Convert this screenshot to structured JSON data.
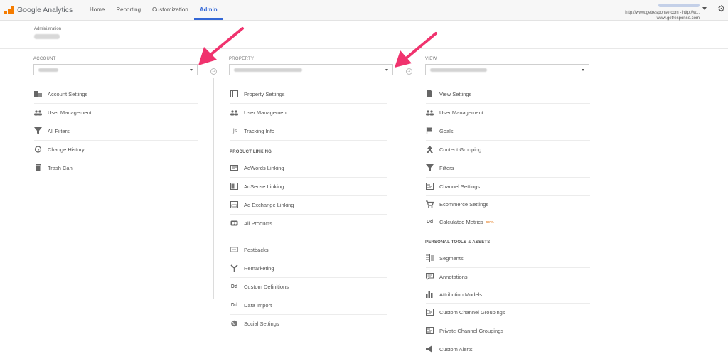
{
  "app": {
    "title": "Google Analytics"
  },
  "nav": [
    "Home",
    "Reporting",
    "Customization",
    "Admin"
  ],
  "account_info": {
    "line1": "http://www.getresponse.com - http://w...",
    "line2": "www.getresponse.com"
  },
  "admin": {
    "label": "Administration"
  },
  "columns": {
    "account": {
      "label": "ACCOUNT",
      "items": [
        "Account Settings",
        "User Management",
        "All Filters",
        "Change History",
        "Trash Can"
      ]
    },
    "property": {
      "label": "PROPERTY",
      "items": [
        "Property Settings",
        "User Management",
        "Tracking Info"
      ],
      "section_label": "PRODUCT LINKING",
      "linking_items": [
        "AdWords Linking",
        "AdSense Linking",
        "Ad Exchange Linking",
        "All Products"
      ],
      "more_items": [
        "Postbacks",
        "Remarketing",
        "Custom Definitions",
        "Data Import",
        "Social Settings"
      ]
    },
    "view": {
      "label": "VIEW",
      "items": [
        "View Settings",
        "User Management",
        "Goals",
        "Content Grouping",
        "Filters",
        "Channel Settings",
        "Ecommerce Settings",
        "Calculated Metrics"
      ],
      "beta_label": "BETA",
      "section_label": "PERSONAL TOOLS & ASSETS",
      "tools_items": [
        "Segments",
        "Annotations",
        "Attribution Models",
        "Custom Channel Groupings",
        "Private Channel Groupings",
        "Custom Alerts"
      ]
    }
  },
  "colors": {
    "accent": "#3367d6",
    "arrow": "#f0336e",
    "logo": "#f57c00"
  }
}
